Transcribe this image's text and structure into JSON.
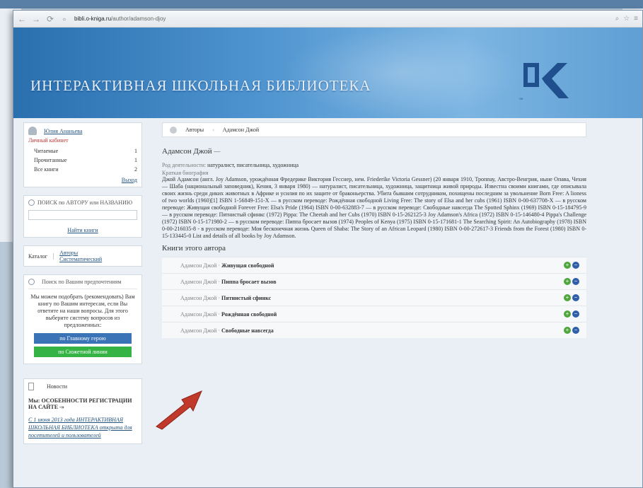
{
  "browser": {
    "url_host": "bibli.o-kniga.ru",
    "url_path": "/author/adamson-djoy"
  },
  "site": {
    "title": "ИНТЕРАКТИВНАЯ ШКОЛЬНАЯ БИБЛИОТЕКА",
    "logo_text": "ОК"
  },
  "user": {
    "name": "Юлия Ананьева",
    "cabinet": "Личный кабинет",
    "stats": [
      {
        "label": "Читаемые",
        "count": "1"
      },
      {
        "label": "Прочитанные",
        "count": "1"
      },
      {
        "label": "Все книги",
        "count": "2"
      }
    ],
    "logout": "Выход"
  },
  "search": {
    "label": "ПОИСК по АВТОРУ или НАЗВАНИЮ",
    "placeholder": "",
    "button": "Найти книги"
  },
  "catalog": {
    "label": "Каталог",
    "links": [
      "Авторы",
      "Систематический"
    ]
  },
  "selection": {
    "header": "Поиск по Вашим предпочтениям",
    "text": "Мы можем подобрать (рекомендовать) Вам книгу по Вашим интересам, если Вы ответите на наши вопросы. Для этого выберите систему вопросов из предложенных:",
    "btn_main": "по Главному герою",
    "btn_plot": "по Сюжетной линии"
  },
  "news": {
    "label": "Новости",
    "title": "Мы: ОСОБЕННОСТИ РЕГИСТРАЦИИ НА САЙТЕ -»",
    "body": "С 1 июня 2013 года ИНТЕРАКТИВНАЯ ШКОЛЬНАЯ БИБЛИОТЕКА открыта для посетителей и пользователей"
  },
  "breadcrumb": {
    "items": [
      "Авторы",
      "Адамсон Джой"
    ]
  },
  "author": {
    "name": "Адамсон Джой",
    "dash": "—",
    "activity_label": "Род деятельности:",
    "activity": "натуралист, писательница, художница",
    "bio_title": "Краткая биография",
    "bio": "Джой Адамсон (англ. Joy Adamson, урождённая Фредерике Виктория Гесснер, нем. Friederike Victoria Gessner) (20 января 1910, Троппау, Австро-Венгрия, ныне Опава, Чехия — Шаба (национальный заповедник), Кения, 3 января 1980) — натуралист, писательница, художница, защитница живой природы. Известна своими книгами, где описывала своих жизнь среди диких животных в Африке и усилия по их защите от браконьерства. Убита бывшим сотрудником, похищены последним за увольнение Born Free: A lioness of two worlds (1960)[1] ISBN 1-56849-151-X — в русском переводе: Рождённая свободной Living Free: The story of Elsa and her cubs (1961) ISBN 0-00-637708-X — в русском переводе: Живущая свободной Forever Free: Elsa's Pride (1964) ISBN 0-00-632883-7 — в русском переводе: Свободные навсегда The Spotted Sphinx (1969) ISBN 0-15-184795-9 — в русском переводе: Пятнистый сфинкс (1972) Pippa: The Cheetah and her Cubs (1970) ISBN 0-15-262125-3 Joy Adamson's Africa (1972) ISBN 0-15-146480-4 Pippa's Challenge (1972) ISBN 0-15-171980-2 — в русском переводе: Пиппа бросает вызов (1974) Peoples of Kenya (1975) ISBN 0-15-171681-1 The Searching Spirit: An Autobiography (1978) ISBN 0-00-216035-8 - в русском переводе: Моя бесконечная жизнь Queen of Shaba: The Story of an African Leopard (1980) ISBN 0-00-272617-3 Friends from the Forest (1980) ISBN 0-15-133445-0 List and details of all books by Joy Adamson."
  },
  "books": {
    "title": "Книги этого автора",
    "items": [
      {
        "author": "Адамсон Джой",
        "title": "Живущая свободной"
      },
      {
        "author": "Адамсон Джой",
        "title": "Пиппа бросает вызов"
      },
      {
        "author": "Адамсон Джой",
        "title": "Пятнистый сфинкс"
      },
      {
        "author": "Адамсон Джой",
        "title": "Рождённая свободной"
      },
      {
        "author": "Адамсон Джой",
        "title": "Свободные навсегда"
      }
    ],
    "add_icon": "plus",
    "info_icon": "minus"
  },
  "colors": {
    "banner": "#4d93cf",
    "link": "#23527c",
    "arrow": "#c0392b",
    "btn_blue": "#3a73b6",
    "btn_green": "#35b445"
  }
}
